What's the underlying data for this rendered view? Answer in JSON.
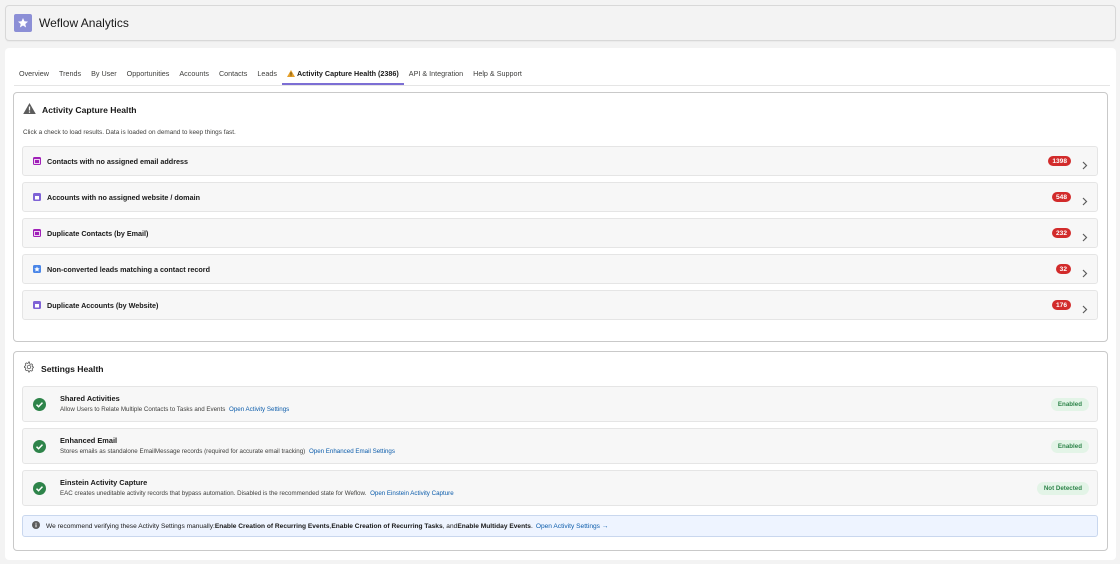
{
  "app": {
    "title": "Weflow Analytics",
    "logo_icon": "star-icon",
    "logo_color": "#8c8fd6"
  },
  "tabs": [
    {
      "label": "Overview"
    },
    {
      "label": "Trends"
    },
    {
      "label": "By User"
    },
    {
      "label": "Opportunities"
    },
    {
      "label": "Accounts"
    },
    {
      "label": "Contacts"
    },
    {
      "label": "Leads"
    },
    {
      "label": "Activity Capture Health (2386)",
      "active": true,
      "icon": "warning-icon"
    },
    {
      "label": "API & Integration"
    },
    {
      "label": "Help & Support"
    }
  ],
  "activity": {
    "title": "Activity Capture Health",
    "icon": "warning-icon",
    "intro": "Click a check to load results. Data is loaded on demand to keep things fast.",
    "checks": [
      {
        "label": "Contacts with no assigned email address",
        "count": "1398",
        "icon": "contact-icon",
        "icon_color": "#a020b8"
      },
      {
        "label": "Accounts with no assigned website / domain",
        "count": "548",
        "icon": "account-icon",
        "icon_color": "#7f63d6"
      },
      {
        "label": "Duplicate Contacts (by Email)",
        "count": "232",
        "icon": "contact-icon",
        "icon_color": "#a020b8"
      },
      {
        "label": "Non-converted leads matching a contact record",
        "count": "32",
        "icon": "lead-icon",
        "icon_color": "#4a86e8"
      },
      {
        "label": "Duplicate Accounts (by Website)",
        "count": "176",
        "icon": "account-icon",
        "icon_color": "#7f63d6"
      }
    ],
    "count_color": "#d22b2b"
  },
  "settings": {
    "title": "Settings Health",
    "icon": "gear-icon",
    "items": [
      {
        "title": "Shared Activities",
        "desc": "Allow Users to Relate Multiple Contacts to Tasks and Events",
        "link": "Open Activity Settings",
        "status": "Enabled"
      },
      {
        "title": "Enhanced Email",
        "desc": "Stores emails as standalone EmailMessage records (required for accurate email tracking)",
        "link": "Open Enhanced Email Settings",
        "status": "Enabled"
      },
      {
        "title": "Einstein Activity Capture",
        "desc": "EAC creates uneditable activity records that bypass automation. Disabled is the recommended state for Weflow.",
        "link": "Open Einstein Activity Capture",
        "status": "Not Detected"
      }
    ],
    "status_color": "#2e844a",
    "info": {
      "prefix": "We recommend verifying these Activity Settings manually:",
      "item1": "Enable Creation of Recurring Events",
      "sep1": ",",
      "item2": "Enable Creation of Recurring Tasks",
      "sep2": ", and",
      "item3": "Enable Multiday Events",
      "suffix": ".",
      "link": "Open Activity Settings →"
    }
  }
}
